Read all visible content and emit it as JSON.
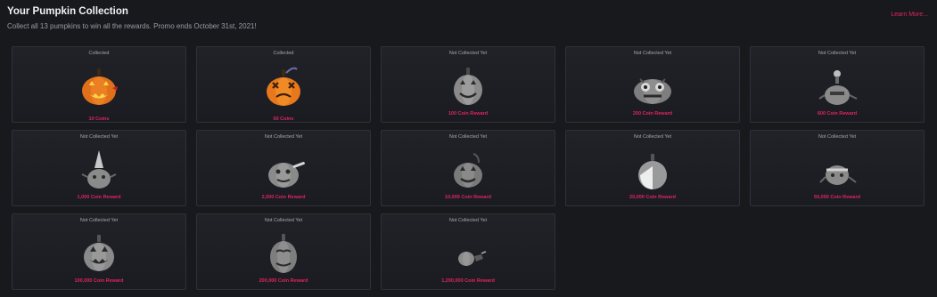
{
  "header": {
    "title": "Your Pumpkin Collection",
    "subtitle": "Collect all 13 pumpkins to win all the rewards. Promo ends October 31st, 2021!",
    "learn_more": "Learn More..."
  },
  "colors": {
    "accent": "#e0245e",
    "background": "#18191d",
    "card": "#1e2026",
    "collected_pumpkin": "#e0701a",
    "uncollected_pumpkin": "#8a8a8a"
  },
  "pumpkins": [
    {
      "status": "Collected",
      "reward": "10 Coins",
      "icon": "jack-o-lantern-icon"
    },
    {
      "status": "Collected",
      "reward": "50 Coins",
      "icon": "jack-o-lantern-icon"
    },
    {
      "status": "Not Collected Yet",
      "reward": "100 Coin Reward",
      "icon": "grey-pumpkin-icon"
    },
    {
      "status": "Not Collected Yet",
      "reward": "200 Coin Reward",
      "icon": "grey-pumpkin-icon"
    },
    {
      "status": "Not Collected Yet",
      "reward": "600 Coin Reward",
      "icon": "grey-pumpkin-icon"
    },
    {
      "status": "Not Collected Yet",
      "reward": "1,000 Coin Reward",
      "icon": "grey-pumpkin-icon"
    },
    {
      "status": "Not Collected Yet",
      "reward": "2,000 Coin Reward",
      "icon": "grey-pumpkin-icon"
    },
    {
      "status": "Not Collected Yet",
      "reward": "10,000 Coin Reward",
      "icon": "grey-pumpkin-icon"
    },
    {
      "status": "Not Collected Yet",
      "reward": "20,000 Coin Reward",
      "icon": "grey-pumpkin-icon"
    },
    {
      "status": "Not Collected Yet",
      "reward": "50,000 Coin Reward",
      "icon": "grey-pumpkin-icon"
    },
    {
      "status": "Not Collected Yet",
      "reward": "100,000 Coin Reward",
      "icon": "grey-pumpkin-icon"
    },
    {
      "status": "Not Collected Yet",
      "reward": "200,000 Coin Reward",
      "icon": "grey-pumpkin-icon"
    },
    {
      "status": "Not Collected Yet",
      "reward": "1,200,000 Coin Reward",
      "icon": "grey-pumpkin-icon"
    }
  ]
}
